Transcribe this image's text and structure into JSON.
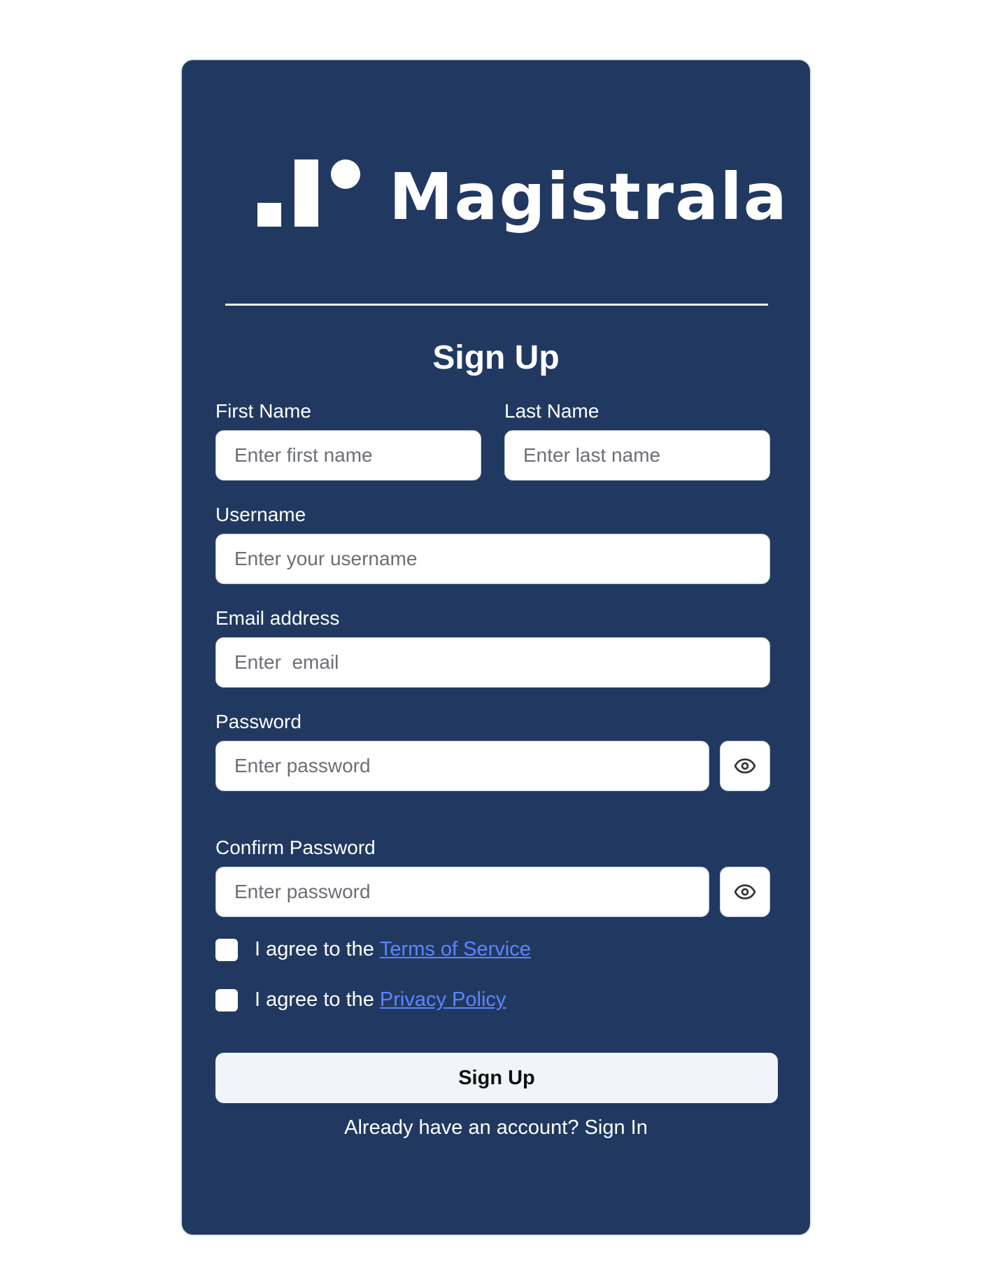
{
  "brand": {
    "name": "Magistrala",
    "logo_icon": "magistrala-logo-icon"
  },
  "form": {
    "title": "Sign Up",
    "first_name": {
      "label": "First Name",
      "placeholder": "Enter first name"
    },
    "last_name": {
      "label": "Last Name",
      "placeholder": "Enter last name"
    },
    "username": {
      "label": "Username",
      "placeholder": "Enter your username"
    },
    "email": {
      "label": "Email address",
      "placeholder": "Enter  email"
    },
    "password": {
      "label": "Password",
      "placeholder": "Enter password",
      "toggle_icon": "eye-icon"
    },
    "confirm_password": {
      "label": "Confirm Password",
      "placeholder": "Enter password",
      "toggle_icon": "eye-icon"
    },
    "terms": {
      "prefix": "I agree to the",
      "link": "Terms of Service"
    },
    "privacy": {
      "prefix": "I agree to the",
      "link": "Privacy Policy"
    },
    "submit_label": "Sign Up",
    "signin_prompt": "Already have an account?",
    "signin_link": "Sign In"
  },
  "colors": {
    "card_background": "#213961",
    "link": "#5b86ff",
    "button_background": "#f1f5fa"
  }
}
